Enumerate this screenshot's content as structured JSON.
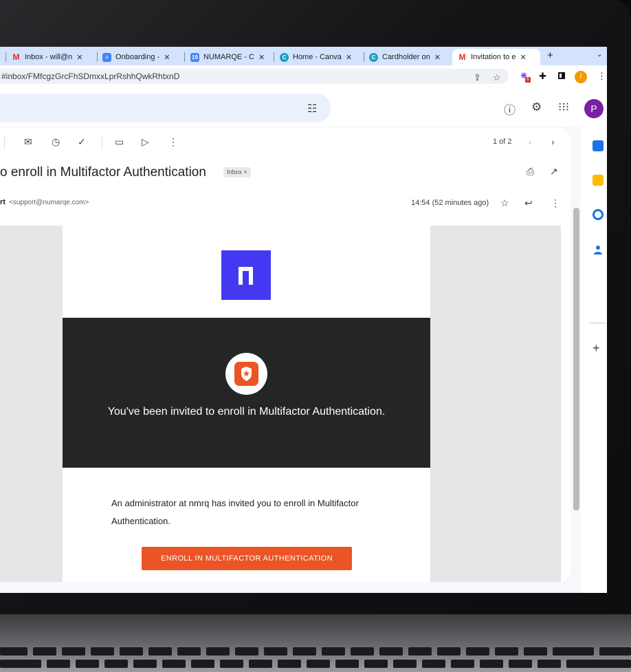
{
  "browser": {
    "tabs": [
      {
        "label": "Inbox - will@n",
        "favicon": "gmail-icon"
      },
      {
        "label": "Onboarding -",
        "favicon": "docs-icon"
      },
      {
        "label": "NUMARQE - C",
        "favicon": "calendar-icon"
      },
      {
        "label": "Home - Canva",
        "favicon": "canva-icon"
      },
      {
        "label": "Cardholder on",
        "favicon": "canva-icon"
      },
      {
        "label": "Invitation to e",
        "favicon": "gmail-icon",
        "active": true
      }
    ],
    "url": "#inbox/FMfcgzGrcFhSDmxxLprRshhQwkRhtxnD",
    "extension_badge": "6",
    "profile_letter": "I"
  },
  "gmail": {
    "avatar_letter": "P",
    "pager": "1 of 2",
    "subject": "o enroll in Multifactor Authentication",
    "label_chip": "Inbox ×",
    "sender_name": "rt",
    "sender_email": "<support@numarqe.com>",
    "timestamp": "14:54 (52 minutes ago)"
  },
  "email": {
    "banner_text": "You've been invited to enroll in Multifactor Authentication.",
    "body_text": "An administrator at nmrq has invited you to enroll in Multifactor Authentication.",
    "button_label": "ENROLL IN MULTIFACTOR AUTHENTICATION"
  },
  "colors": {
    "brand_purple": "#4439f2",
    "accent_orange": "#eb5424",
    "banner_dark": "#242527",
    "tab_bar": "#d3e3fd"
  }
}
